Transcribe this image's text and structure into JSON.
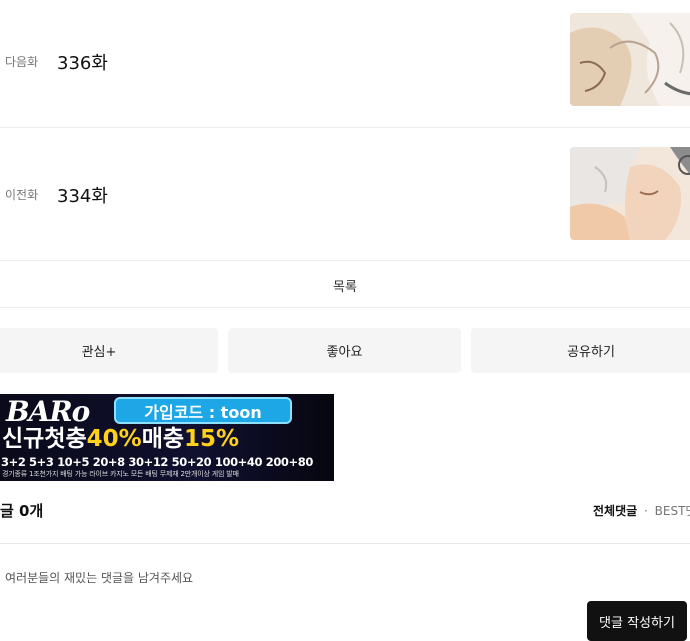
{
  "episodes": [
    {
      "label": "다음화",
      "title": "336화"
    },
    {
      "label": "이전화",
      "title": "334화"
    }
  ],
  "list_label": "목록",
  "actions": {
    "follow": "관심+",
    "like": "좋아요",
    "share": "공유하기"
  },
  "banner": {
    "brand": "BARo",
    "code": "가입코드 : toon",
    "headline_a": "신규첫충",
    "headline_b": "40%",
    "headline_c": "매충",
    "headline_d": "15%",
    "bonus": "3+2 5+3 10+5 20+8 30+12 50+20 100+40 200+80",
    "fine": "경기종류 1조천가지 배팅 가능 라이브 카지노 모든 배팅 무제재 2만개이상 게임 발매"
  },
  "comments": {
    "count_label": "글 0개",
    "tab_all": "전체댓글",
    "tab_sep": "·",
    "tab_best": "BEST댓",
    "placeholder": "여러분들의 재밌는 댓글을 남겨주세요",
    "write_label": "댓글 작성하기"
  }
}
